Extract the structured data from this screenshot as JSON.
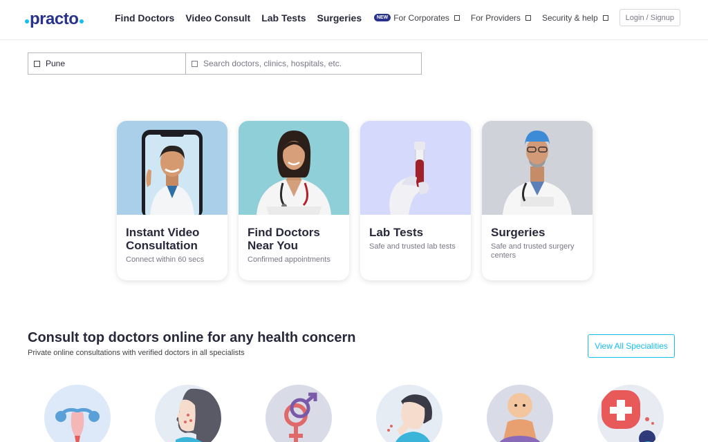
{
  "header": {
    "logo": "practo",
    "nav": [
      "Find Doctors",
      "Video Consult",
      "Lab Tests",
      "Surgeries"
    ],
    "corporates": {
      "badge": "NEW",
      "label": "For Corporates"
    },
    "providers": "For Providers",
    "security": "Security & help",
    "login": "Login / Signup"
  },
  "search": {
    "location": "Pune",
    "placeholder": "Search doctors, clinics, hospitals, etc."
  },
  "cards": [
    {
      "title": "Instant Video Consultation",
      "subtitle": "Connect within 60 secs",
      "bg": "#a9cfe9"
    },
    {
      "title": "Find Doctors Near You",
      "subtitle": "Confirmed appointments",
      "bg": "#8ecfd8"
    },
    {
      "title": "Lab Tests",
      "subtitle": "Safe and trusted lab tests",
      "bg": "#d5d9fb"
    },
    {
      "title": "Surgeries",
      "subtitle": "Safe and trusted surgery centers",
      "bg": "#cfd2d9"
    }
  ],
  "section": {
    "title": "Consult top doctors online for any health concern",
    "subtitle": "Private online consultations with verified doctors in all specialists",
    "view_all": "View All Specialities"
  },
  "specialities_icons": [
    "uterus-icon",
    "skin-icon",
    "gender-symbols-icon",
    "cough-icon",
    "baby-icon",
    "medical-cross-icon"
  ],
  "colors": {
    "brand": "#14bef0",
    "brand_dark": "#28328c"
  }
}
